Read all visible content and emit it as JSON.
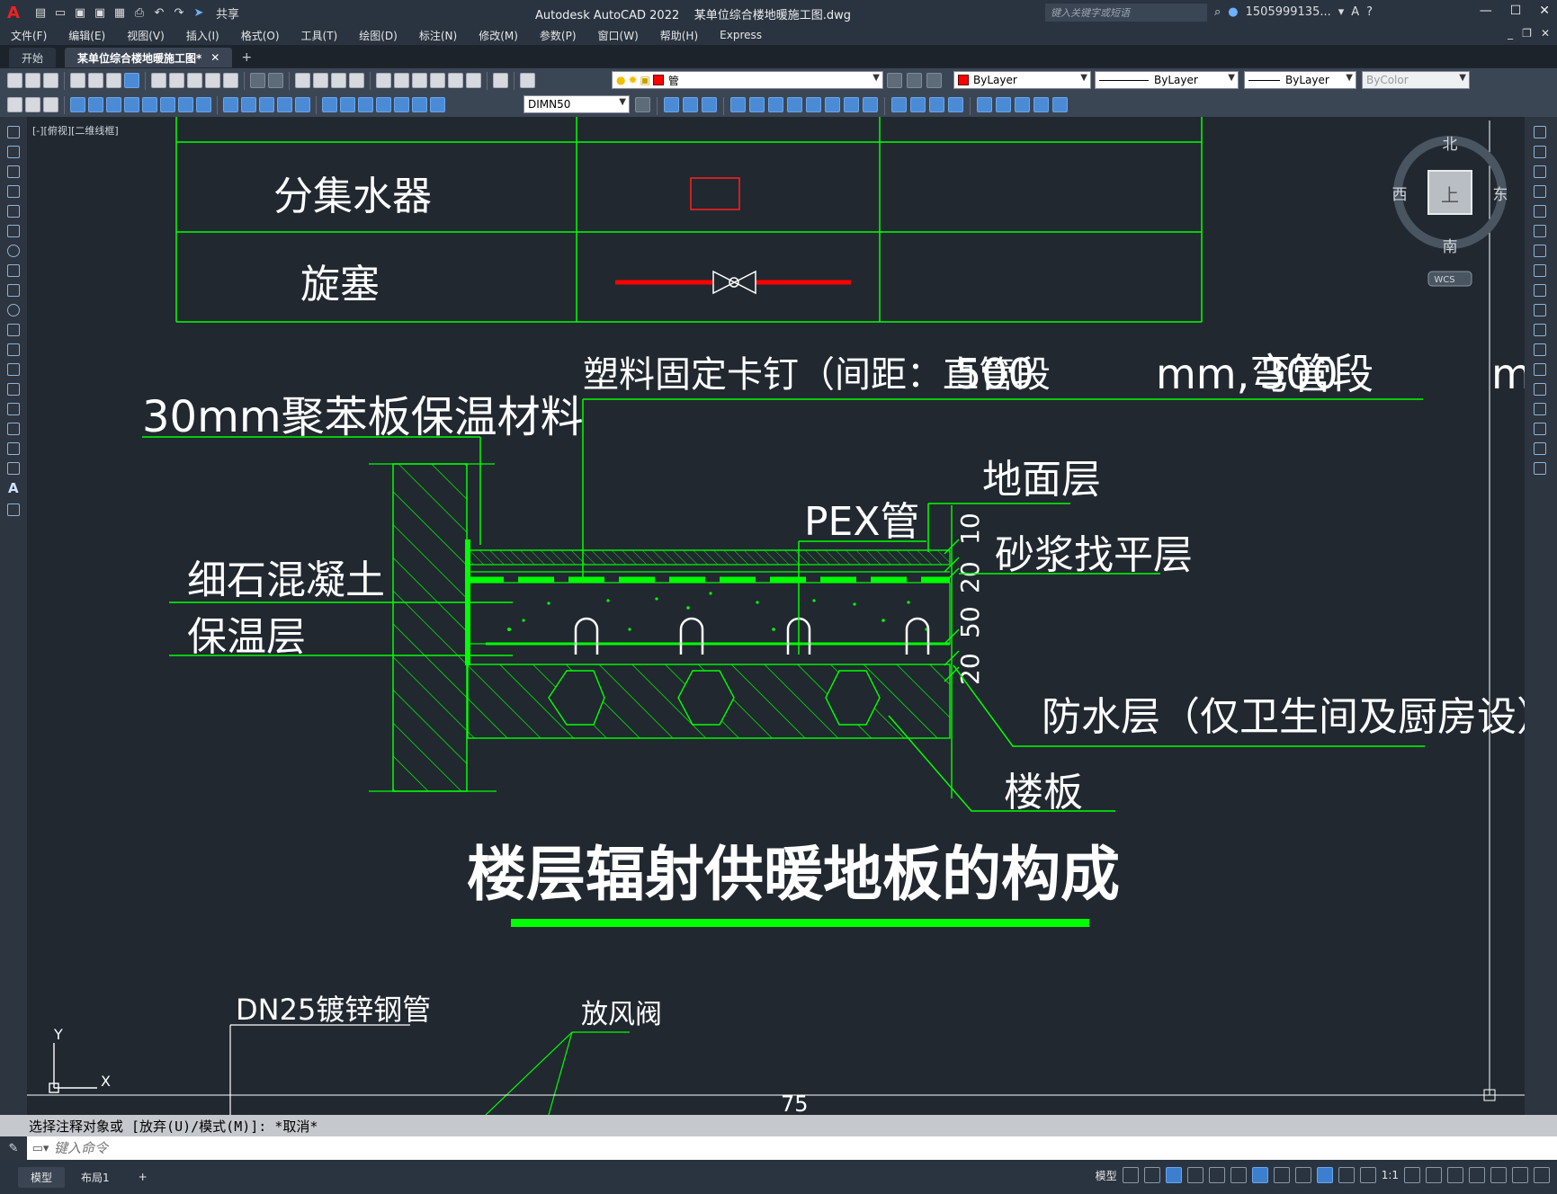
{
  "title_bar": {
    "app_title": "Autodesk AutoCAD 2022",
    "file_name": "某单位综合楼地暖施工图.dwg",
    "share_label": "共享",
    "search_placeholder": "键入关键字或短语",
    "user_name": "1505999135..."
  },
  "menu": [
    "文件(F)",
    "编辑(E)",
    "视图(V)",
    "插入(I)",
    "格式(O)",
    "工具(T)",
    "绘图(D)",
    "标注(N)",
    "修改(M)",
    "参数(P)",
    "窗口(W)",
    "帮助(H)",
    "Express"
  ],
  "tabs": [
    {
      "label": "开始"
    },
    {
      "label": "某单位综合楼地暖施工图*"
    }
  ],
  "toolbar": {
    "layer_value": "管",
    "color_value": "ByLayer",
    "linetype_value": "ByLayer",
    "lineweight_value": "ByLayer",
    "plotstyle_value": "ByColor",
    "dimstyle_value": "DIMN50"
  },
  "viewport_label": "[-][俯视][二维线框]",
  "viewcube": {
    "north": "北",
    "south": "南",
    "east": "东",
    "west": "西",
    "top": "上",
    "wcs": "WCS"
  },
  "drawing": {
    "legend_rows": [
      {
        "name": "分集水器"
      },
      {
        "name": "旋塞"
      }
    ],
    "labels": {
      "clip_note_a": "塑料固定卡钉（间距：直管段",
      "clip_note_num_a": "500",
      "clip_note_b": "mm,弯管段",
      "clip_note_num_b": "300",
      "clip_note_c": "m",
      "insulation_board": "30mm聚苯板保温材料",
      "ground_layer": "地面层",
      "pex_pipe": "PEX管",
      "mortar_layer": "砂浆找平层",
      "fine_concrete": "细石混凝土",
      "insulation_layer": "保温层",
      "waterproof_layer": "防水层（仅卫生间及厨房设）",
      "floor_slab": "楼板",
      "main_title": "楼层辐射供暖地板的构成",
      "dn25": "DN25镀锌钢管",
      "air_valve": "放风阀",
      "dim_10": "10",
      "dim_20a": "20",
      "dim_50": "50",
      "dim_20b": "20",
      "dim_75": "75",
      "axis_y": "Y",
      "axis_x": "X"
    }
  },
  "command": {
    "history": "选择注释对象或 [放弃(U)/模式(M)]: *取消*",
    "placeholder": "键入命令"
  },
  "status": {
    "model_tab": "模型",
    "layout_tab": "布局1",
    "model_label": "模型",
    "scale": "1:1"
  }
}
